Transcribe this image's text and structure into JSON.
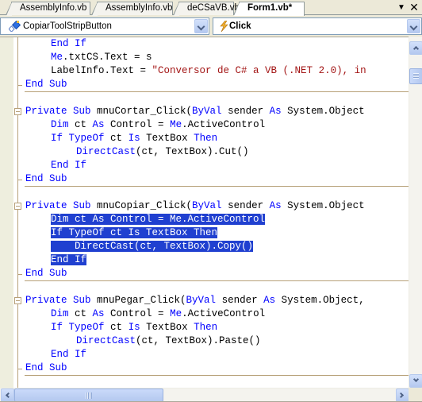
{
  "tabs": [
    {
      "label": "AssemblyInfo.vb",
      "active": false
    },
    {
      "label": "AssemblyInfo.vb",
      "active": false
    },
    {
      "label": "deCSaVB.vb",
      "active": false
    },
    {
      "label": "Form1.vb*",
      "active": true
    }
  ],
  "tab_controls": {
    "dropdown_icon": "▼",
    "close_icon": "✕"
  },
  "navbar": {
    "class_combo": {
      "value": "CopiarToolStripButton",
      "icon": "tool-strip-button-icon"
    },
    "method_combo": {
      "value": "Click",
      "icon": "lightning-event-icon"
    }
  },
  "editor": {
    "lines": [
      {
        "indent": 2,
        "tokens": [
          {
            "t": "End If",
            "c": "kw"
          }
        ]
      },
      {
        "indent": 2,
        "tokens": [
          {
            "t": "Me",
            "c": "kw"
          },
          {
            "t": ".txtCS.Text = s",
            "c": ""
          }
        ]
      },
      {
        "indent": 2,
        "tokens": [
          {
            "t": "LabelInfo.Text = ",
            "c": ""
          },
          {
            "t": "\"Conversor de C# a VB (.NET 2.0), in",
            "c": "str"
          }
        ]
      },
      {
        "indent": 1,
        "tokens": [
          {
            "t": "End Sub",
            "c": "kw"
          }
        ]
      },
      {
        "indent": 0,
        "tokens": []
      },
      {
        "indent": 1,
        "tokens": [
          {
            "t": "Private Sub",
            "c": "kw"
          },
          {
            "t": " mnuCortar_Click(",
            "c": ""
          },
          {
            "t": "ByVal",
            "c": "kw"
          },
          {
            "t": " sender ",
            "c": ""
          },
          {
            "t": "As",
            "c": "kw"
          },
          {
            "t": " System.Object",
            "c": ""
          }
        ]
      },
      {
        "indent": 2,
        "tokens": [
          {
            "t": "Dim",
            "c": "kw"
          },
          {
            "t": " ct ",
            "c": ""
          },
          {
            "t": "As",
            "c": "kw"
          },
          {
            "t": " Control = ",
            "c": ""
          },
          {
            "t": "Me",
            "c": "kw"
          },
          {
            "t": ".ActiveControl",
            "c": ""
          }
        ]
      },
      {
        "indent": 2,
        "tokens": [
          {
            "t": "If",
            "c": "kw"
          },
          {
            "t": " ",
            "c": ""
          },
          {
            "t": "TypeOf",
            "c": "kw"
          },
          {
            "t": " ct ",
            "c": ""
          },
          {
            "t": "Is",
            "c": "kw"
          },
          {
            "t": " TextBox ",
            "c": ""
          },
          {
            "t": "Then",
            "c": "kw"
          }
        ]
      },
      {
        "indent": 3,
        "tokens": [
          {
            "t": "DirectCast",
            "c": "kw"
          },
          {
            "t": "(ct, TextBox).Cut()",
            "c": ""
          }
        ]
      },
      {
        "indent": 2,
        "tokens": [
          {
            "t": "End If",
            "c": "kw"
          }
        ]
      },
      {
        "indent": 1,
        "tokens": [
          {
            "t": "End Sub",
            "c": "kw"
          }
        ]
      },
      {
        "indent": 0,
        "tokens": []
      },
      {
        "indent": 1,
        "tokens": [
          {
            "t": "Private Sub",
            "c": "kw"
          },
          {
            "t": " mnuCopiar_Click(",
            "c": ""
          },
          {
            "t": "ByVal",
            "c": "kw"
          },
          {
            "t": " sender ",
            "c": ""
          },
          {
            "t": "As",
            "c": "kw"
          },
          {
            "t": " System.Object",
            "c": ""
          }
        ]
      },
      {
        "indent": 2,
        "selected": true,
        "tokens": [
          {
            "t": "Dim ct As Control = Me.ActiveControl",
            "c": ""
          }
        ]
      },
      {
        "indent": 2,
        "selected": true,
        "tokens": [
          {
            "t": "If TypeOf ct Is TextBox Then",
            "c": ""
          }
        ]
      },
      {
        "indent": 2,
        "selected": true,
        "tokens": [
          {
            "t": "    DirectCast(ct, TextBox).Copy()",
            "c": ""
          }
        ]
      },
      {
        "indent": 2,
        "selected": true,
        "tokens": [
          {
            "t": "End If",
            "c": ""
          }
        ]
      },
      {
        "indent": 1,
        "tokens": [
          {
            "t": "End Sub",
            "c": "kw"
          }
        ]
      },
      {
        "indent": 0,
        "tokens": []
      },
      {
        "indent": 1,
        "tokens": [
          {
            "t": "Private Sub",
            "c": "kw"
          },
          {
            "t": " mnuPegar_Click(",
            "c": ""
          },
          {
            "t": "ByVal",
            "c": "kw"
          },
          {
            "t": " sender ",
            "c": ""
          },
          {
            "t": "As",
            "c": "kw"
          },
          {
            "t": " System.Object,",
            "c": ""
          }
        ]
      },
      {
        "indent": 2,
        "tokens": [
          {
            "t": "Dim",
            "c": "kw"
          },
          {
            "t": " ct ",
            "c": ""
          },
          {
            "t": "As",
            "c": "kw"
          },
          {
            "t": " Control = ",
            "c": ""
          },
          {
            "t": "Me",
            "c": "kw"
          },
          {
            "t": ".ActiveControl",
            "c": ""
          }
        ]
      },
      {
        "indent": 2,
        "tokens": [
          {
            "t": "If",
            "c": "kw"
          },
          {
            "t": " ",
            "c": ""
          },
          {
            "t": "TypeOf",
            "c": "kw"
          },
          {
            "t": " ct ",
            "c": ""
          },
          {
            "t": "Is",
            "c": "kw"
          },
          {
            "t": " TextBox ",
            "c": ""
          },
          {
            "t": "Then",
            "c": "kw"
          }
        ]
      },
      {
        "indent": 3,
        "tokens": [
          {
            "t": "DirectCast",
            "c": "kw"
          },
          {
            "t": "(ct, TextBox).Paste()",
            "c": ""
          }
        ]
      },
      {
        "indent": 2,
        "tokens": [
          {
            "t": "End If",
            "c": "kw"
          }
        ]
      },
      {
        "indent": 1,
        "tokens": [
          {
            "t": "End Sub",
            "c": "kw"
          }
        ]
      }
    ]
  },
  "colors": {
    "keyword": "#0000ff",
    "string": "#a31515",
    "selection": "#2040d0",
    "outline": "#b7a078"
  }
}
